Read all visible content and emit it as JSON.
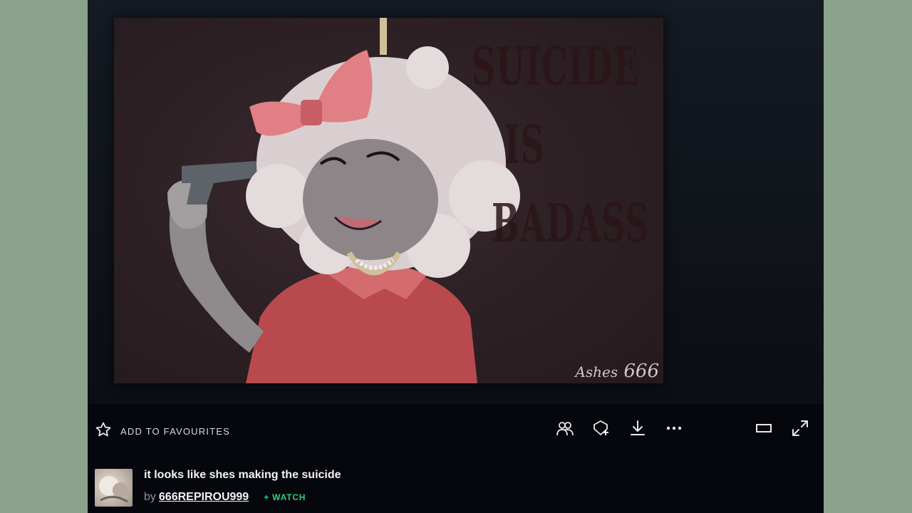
{
  "artwork": {
    "wall_lines": [
      "SUICIDE",
      "IS",
      "BADASS"
    ],
    "signature_prefix": "Ashes",
    "signature_number": "666"
  },
  "toolbar": {
    "favourite_label": "ADD TO FAVOURITES",
    "icons": [
      "star-icon",
      "group-icon",
      "gift-icon",
      "download-icon",
      "more-icon",
      "theater-mode-icon",
      "fullscreen-icon"
    ]
  },
  "deviation": {
    "title": "it looks like shes making the suicide",
    "by_label": "by",
    "author": "666REPIROU999",
    "watch_label": "+ WATCH"
  },
  "colors": {
    "background": "#8aa38a",
    "stage": "#06070d",
    "watch_accent": "#2bd17a"
  }
}
